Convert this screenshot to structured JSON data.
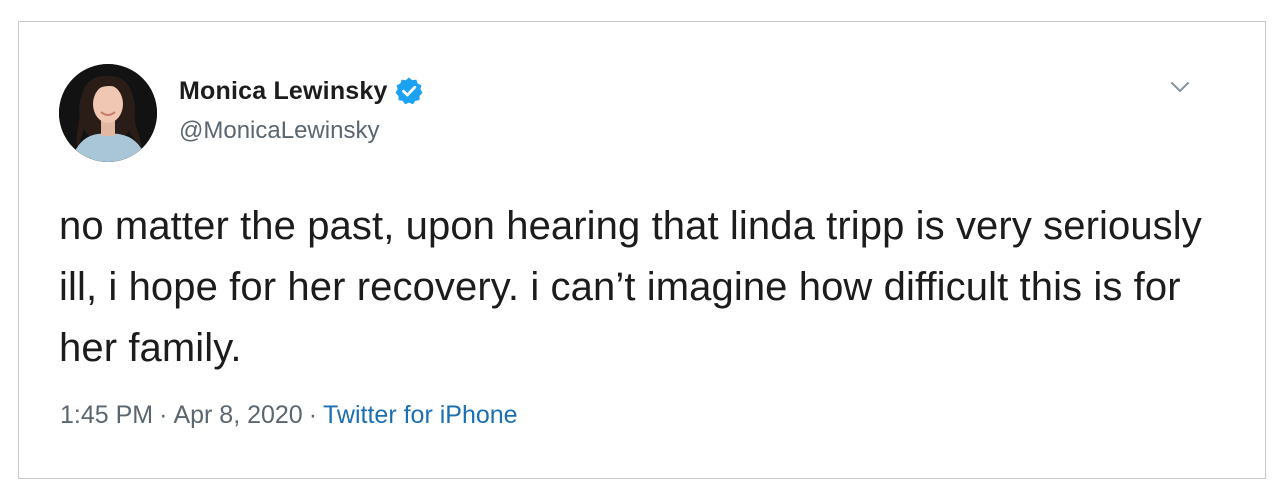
{
  "tweet": {
    "display_name": "Monica Lewinsky",
    "handle": "@MonicaLewinsky",
    "text": "no matter the past, upon hearing that linda tripp is very seriously ill, i hope for her recovery. i can’t imagine how difficult this is for her family.",
    "time": "1:45 PM",
    "separator": "·",
    "date": "Apr 8, 2020",
    "source": "Twitter for iPhone"
  },
  "icons": {
    "verified": "verified-badge-icon",
    "menu": "chevron-down-icon",
    "avatar": "profile-photo"
  },
  "colors": {
    "verified_badge": "#1da1f2",
    "source_link": "#1b6fb2",
    "secondary_text": "#5b6670",
    "primary_text": "#1c1c1c",
    "card_border": "#c9c9c9"
  }
}
